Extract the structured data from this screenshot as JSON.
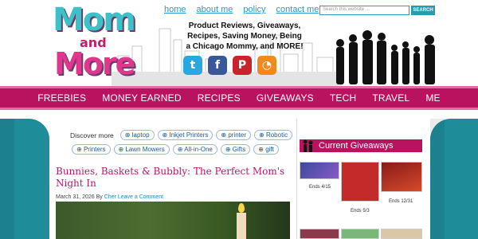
{
  "header": {
    "logo": {
      "line1": "Mom",
      "line2": "and",
      "line3": "More"
    },
    "top_links": [
      "home",
      "about me",
      "policy",
      "contact me"
    ],
    "search": {
      "placeholder": "Search this website …",
      "button": "SEARCH"
    },
    "tagline": "Product Reviews, Giveaways, Recipes, Saving Money, Being a Chicago Mommy, and MORE!",
    "social": [
      {
        "name": "twitter-icon",
        "glyph": "t"
      },
      {
        "name": "facebook-icon",
        "glyph": "f"
      },
      {
        "name": "pinterest-icon",
        "glyph": "P"
      },
      {
        "name": "rss-icon",
        "glyph": "◔"
      }
    ]
  },
  "main_nav": [
    "FREEBIES",
    "MONEY EARNED",
    "RECIPES",
    "GIVEAWAYS",
    "TECH",
    "TRAVEL",
    "ME"
  ],
  "discover": {
    "label": "Discover more",
    "row1": [
      "laptop",
      "Inkjet Printers",
      "printer",
      "Robotic"
    ],
    "row2": [
      "Printers",
      "Lawn Mowers",
      "All-in-One",
      "Gifts",
      "gift"
    ]
  },
  "post": {
    "title": "Bunnies, Baskets & Bubbly: The Perfect Mom's Night In",
    "date": "March 31, 2026",
    "by": "By",
    "author": "Cher",
    "comment": "Leave a Comment"
  },
  "widget": {
    "title": "Current Giveaways",
    "icon": "family-icon",
    "items": [
      {
        "caption": "Ends 4/15"
      },
      {
        "caption": "Ends 5/3"
      },
      {
        "caption": "Ends 12/31"
      }
    ]
  },
  "colors": {
    "brand_magenta": "#b9135f",
    "brand_teal": "#1f8c99",
    "link_blue": "#2a98c8"
  }
}
